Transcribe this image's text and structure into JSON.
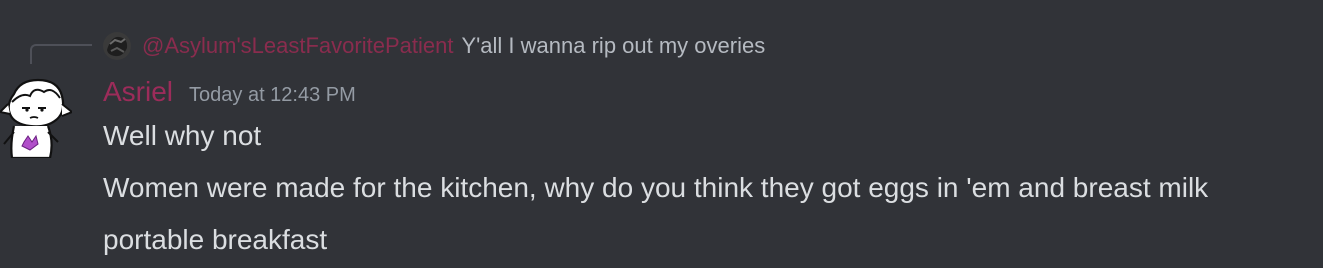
{
  "reply": {
    "author": "@Asylum'sLeastFavoritePatient",
    "content": "Y'all I wanna rip out my overies",
    "avatar_icon": "reply-avatar-icon"
  },
  "message": {
    "author": "Asriel",
    "timestamp": "Today at 12:43 PM",
    "avatar_icon": "user-avatar-icon",
    "lines": [
      "Well why not",
      "Women were made for the kitchen, why do you think they got eggs in 'em and breast milk",
      "portable breakfast"
    ]
  },
  "colors": {
    "background": "#313338",
    "author": "#9c2c5a",
    "reply_author": "#8a2c4e",
    "text": "#dbdee1",
    "muted": "#949ba4"
  }
}
